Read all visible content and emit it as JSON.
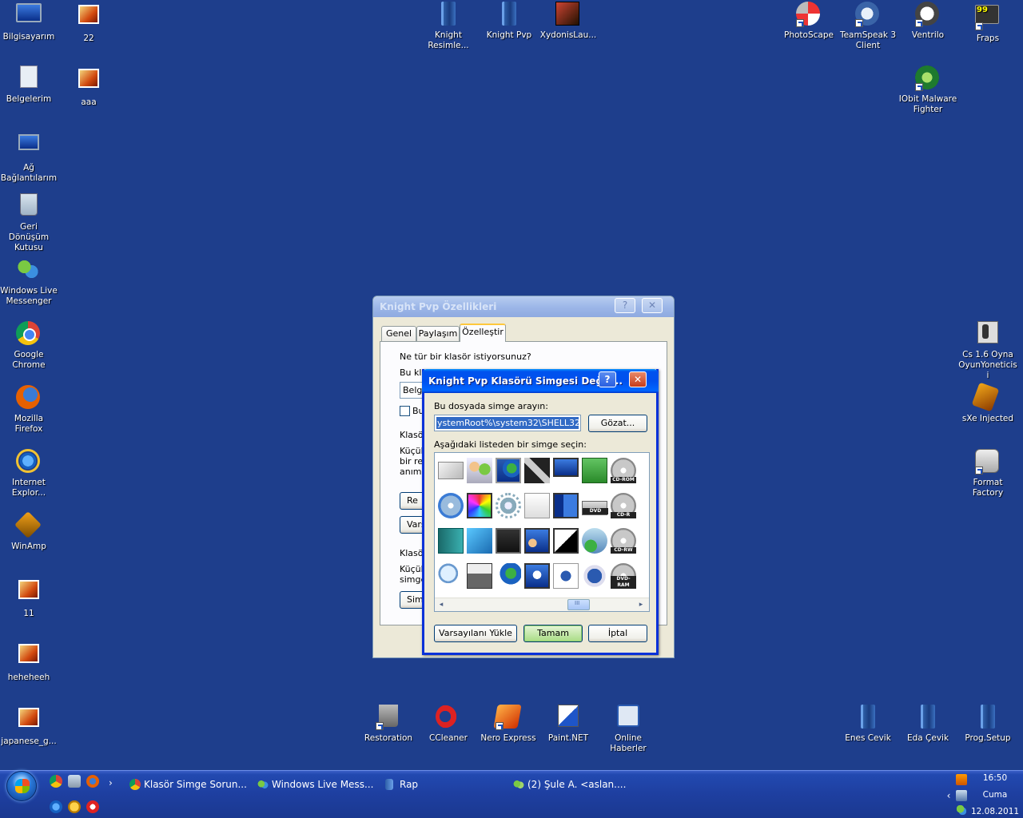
{
  "desktop": {
    "icons": [
      {
        "label": "Bilgisayarım",
        "icon": "computer-icon"
      },
      {
        "label": "22",
        "icon": "photo-icon"
      },
      {
        "label": "Belgelerim",
        "icon": "documents-icon"
      },
      {
        "label": "aaa",
        "icon": "photo-icon"
      },
      {
        "label": "Ağ Bağlantılarım",
        "icon": "network-icon"
      },
      {
        "label": "Geri Dönüşüm Kutusu",
        "icon": "recycle-bin-icon"
      },
      {
        "label": "Windows Live Messenger",
        "icon": "messenger-icon"
      },
      {
        "label": "Google Chrome",
        "icon": "chrome-icon"
      },
      {
        "label": "Mozilla Firefox",
        "icon": "firefox-icon"
      },
      {
        "label": "Internet Explor...",
        "icon": "internet-explorer-icon"
      },
      {
        "label": "WinAmp",
        "icon": "winamp-icon"
      },
      {
        "label": "11",
        "icon": "photo-icon"
      },
      {
        "label": "heheheeh",
        "icon": "photo-icon"
      },
      {
        "label": "japanese_g...",
        "icon": "photo-icon"
      },
      {
        "label": "Knight Resimle...",
        "icon": "folder-icon"
      },
      {
        "label": "Knight Pvp",
        "icon": "folder-icon"
      },
      {
        "label": "XydonisLau...",
        "icon": "game-launcher-icon"
      },
      {
        "label": "PhotoScape",
        "icon": "photoscape-icon"
      },
      {
        "label": "TeamSpeak 3 Client",
        "icon": "teamspeak-icon"
      },
      {
        "label": "Ventrilo",
        "icon": "ventrilo-icon"
      },
      {
        "label": "Fraps",
        "icon": "fraps-icon"
      },
      {
        "label": "IObit Malware Fighter",
        "icon": "iobit-icon"
      },
      {
        "label": "Cs 1.6 Oyna OyunYoneticisi",
        "icon": "counter-strike-icon"
      },
      {
        "label": "sXe Injected",
        "icon": "sxe-icon"
      },
      {
        "label": "Format Factory",
        "icon": "format-factory-icon"
      },
      {
        "label": "Restoration",
        "icon": "restoration-icon"
      },
      {
        "label": "CCleaner",
        "icon": "ccleaner-icon"
      },
      {
        "label": "Nero Express",
        "icon": "nero-icon"
      },
      {
        "label": "Paint.NET",
        "icon": "paint-net-icon"
      },
      {
        "label": "Online Haberler",
        "icon": "online-news-icon"
      },
      {
        "label": "Enes Cevik",
        "icon": "folder-icon"
      },
      {
        "label": "Eda Çevik",
        "icon": "folder-icon"
      },
      {
        "label": "Prog.Setup",
        "icon": "folder-icon"
      }
    ]
  },
  "properties_window": {
    "title": "Knight Pvp Özellikleri",
    "help_btn": "?",
    "close_btn": "✕",
    "tabs": [
      "Genel",
      "Paylaşım",
      "Özelleştir"
    ],
    "active_tab": "Özelleştir",
    "q_folder_type": "Ne tür bir klasör istiyorsunuz?",
    "use_template_label": "Bu klasör türünü şablon olarak kullan:",
    "template_value": "Belge",
    "also_apply_check": "Bu",
    "folder_pictures_group": "Klasör",
    "folder_pictures_desc1": "Küçük",
    "folder_pictures_desc2": "bir res",
    "folder_pictures_desc3": "anımsa",
    "choose_picture_btn": "Re",
    "restore_default_btn": "Vars",
    "folder_icons_group": "Klasör",
    "folder_icons_desc1": "Küçük",
    "folder_icons_desc2": "simge",
    "change_icon_btn": "Sim"
  },
  "change_icon_dialog": {
    "title": "Knight Pvp Klasörü Simgesi Değiş...",
    "help_btn": "?",
    "close_btn": "✕",
    "look_in_label": "Bu dosyada simge arayın:",
    "file_path": "ystemRoot%\\system32\\SHELL32.dll",
    "browse_btn": "Gözat...",
    "select_label": "Aşağıdaki listeden bir simge seçin:",
    "icons": [
      "envelope-icon",
      "users-icon",
      "globe-monitor-icon",
      "tools-icon",
      "monitor-icon",
      "green-arrow-icon",
      "cdrom-icon",
      "cd-icon",
      "display-properties-icon",
      "gear-icon",
      "search-settings-icon",
      "network-monitor-icon",
      "dvd-drive-icon",
      "cdr-icon",
      "book-icon",
      "media-icon",
      "monitor-gear-icon",
      "user-monitor-icon",
      "contrast-icon",
      "music-add-icon",
      "cdrw-icon",
      "magnifier-icon",
      "printer-icon",
      "globe-clock-icon",
      "monitor-search-icon",
      "help-doc-icon",
      "help-icon",
      "dvdram-icon"
    ],
    "drive_labels": {
      "cdrom": "CD-ROM",
      "dvd": "DVD",
      "cdr": "CD-R",
      "cdrw": "CD-RW",
      "dvdram": "DVD-RAM"
    },
    "restore_defaults_btn": "Varsayılanı Yükle",
    "ok_btn": "Tamam",
    "cancel_btn": "İptal"
  },
  "taskbar": {
    "start_label": "",
    "chevron": "›",
    "buttons": [
      {
        "label": "Klasör Simge Sorun...",
        "icon": "chrome-icon"
      },
      {
        "label": "Windows Live Mess...",
        "icon": "messenger-icon"
      },
      {
        "label": "Rap",
        "icon": "folder-icon"
      },
      {
        "label": "(2) Şule A. <aslan....",
        "icon": "messenger-chat-icon"
      }
    ],
    "tray": {
      "time": "16:50",
      "day": "Cuma",
      "date": "12.08.2011",
      "expand": "‹"
    }
  },
  "colors": {
    "desktop_bg": "#1e3e8c",
    "titlebar_active": "#0053ee",
    "titlebar_inactive": "#9db7e8",
    "dialog_face": "#ece9d8",
    "selection": "#316ac5"
  }
}
